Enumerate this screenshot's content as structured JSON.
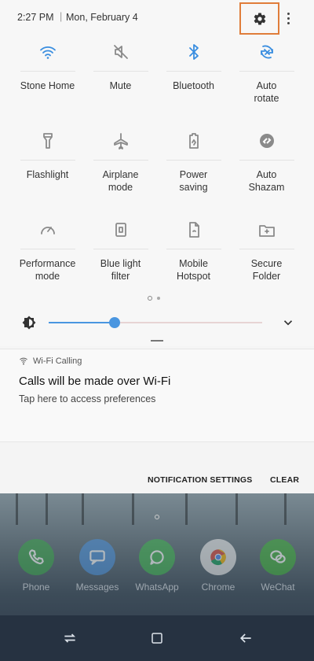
{
  "status_bar": {
    "time": "2:27 PM",
    "separator": "|",
    "date": "Mon, February 4",
    "settings_icon": "gear-icon",
    "more_icon": "more-vert-icon",
    "highlight_color": "#e07d3a"
  },
  "tiles": [
    {
      "label": "Stone Home",
      "icon": "wifi-icon",
      "active": true
    },
    {
      "label": "Mute",
      "icon": "mute-icon",
      "active": false
    },
    {
      "label": "Bluetooth",
      "icon": "bluetooth-icon",
      "active": true
    },
    {
      "label": "Auto\nrotate",
      "icon": "auto-rotate-icon",
      "active": true
    },
    {
      "label": "Flashlight",
      "icon": "flashlight-icon",
      "active": false
    },
    {
      "label": "Airplane\nmode",
      "icon": "airplane-icon",
      "active": false
    },
    {
      "label": "Power\nsaving",
      "icon": "power-saving-icon",
      "active": false
    },
    {
      "label": "Auto\nShazam",
      "icon": "shazam-icon",
      "active": false
    },
    {
      "label": "Performance\nmode",
      "icon": "performance-icon",
      "active": false
    },
    {
      "label": "Blue light\nfilter",
      "icon": "blue-light-icon",
      "active": false
    },
    {
      "label": "Mobile\nHotspot",
      "icon": "hotspot-icon",
      "active": false
    },
    {
      "label": "Secure\nFolder",
      "icon": "secure-folder-icon",
      "active": false
    }
  ],
  "brightness": {
    "level": 0.31,
    "icon": "brightness-icon",
    "expand_icon": "chevron-down-icon",
    "accent": "#4a96e0"
  },
  "notification": {
    "app_name": "Wi-Fi Calling",
    "app_icon": "wifi-calling-icon",
    "title": "Calls will be made over Wi-Fi",
    "body": "Tap here to access preferences"
  },
  "actions": {
    "settings_label": "NOTIFICATION SETTINGS",
    "clear_label": "CLEAR"
  },
  "home_apps": [
    {
      "label": "Phone",
      "icon": "phone-icon",
      "color": "#3aa34a"
    },
    {
      "label": "Messages",
      "icon": "messages-icon",
      "color": "#4a8fd8"
    },
    {
      "label": "WhatsApp",
      "icon": "whatsapp-icon",
      "color": "#3fb24f"
    },
    {
      "label": "Chrome",
      "icon": "chrome-icon",
      "color": "#e8e8e8"
    },
    {
      "label": "WeChat",
      "icon": "wechat-icon",
      "color": "#3fae3a"
    }
  ],
  "navbar": {
    "recents_icon": "recents-icon",
    "home_icon": "home-icon",
    "back_icon": "back-icon"
  },
  "colors": {
    "active_tile": "#3a8ee0",
    "inactive_tile": "#8a8a8a"
  }
}
